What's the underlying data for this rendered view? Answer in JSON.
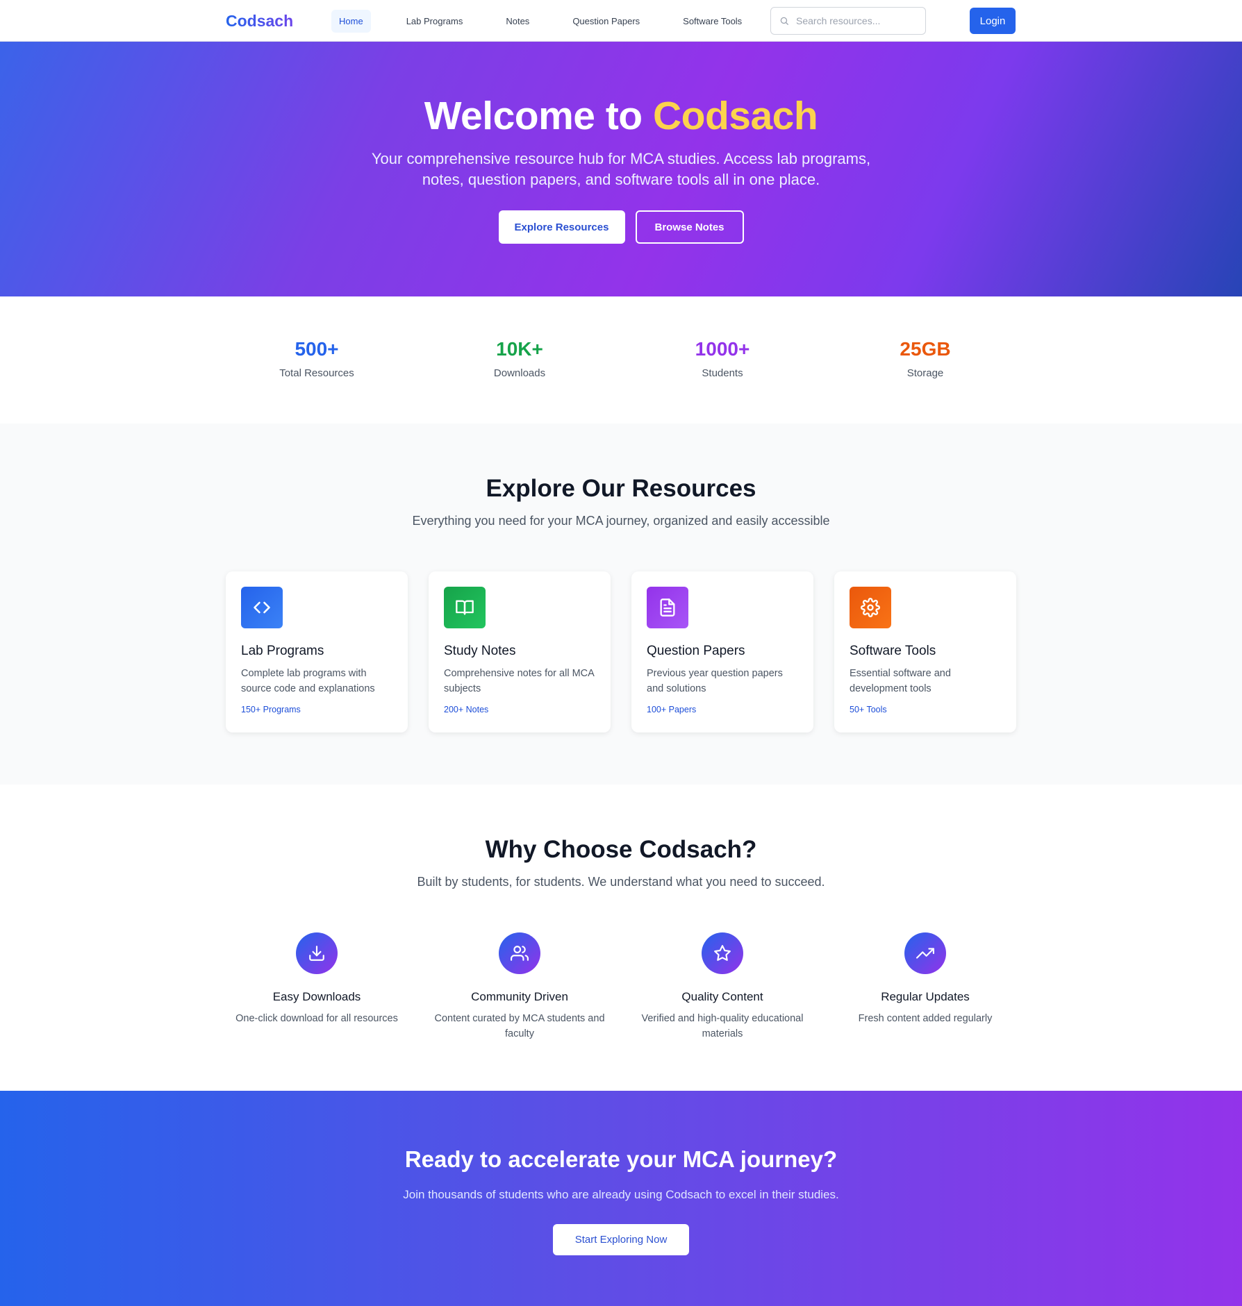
{
  "nav": {
    "logo": "Codsach",
    "links": [
      {
        "label": "Home",
        "active": true
      },
      {
        "label": "Lab Programs"
      },
      {
        "label": "Notes"
      },
      {
        "label": "Question Papers"
      },
      {
        "label": "Software Tools"
      }
    ],
    "search_placeholder": "Search resources...",
    "login_label": "Login"
  },
  "hero": {
    "title_prefix": "Welcome to",
    "title_accent": "Codsach",
    "subtitle": "Your comprehensive resource hub for MCA studies. Access lab programs, notes, question papers, and software tools all in one place.",
    "primary_button": "Explore Resources",
    "secondary_button": "Browse Notes"
  },
  "stats": [
    {
      "value": "500+",
      "label": "Total Resources",
      "color": "#2563eb"
    },
    {
      "value": "10K+",
      "label": "Downloads",
      "color": "#16a34a"
    },
    {
      "value": "1000+",
      "label": "Students",
      "color": "#9333ea"
    },
    {
      "value": "25GB",
      "label": "Storage",
      "color": "#ea580c"
    }
  ],
  "resources": {
    "title": "Explore Our Resources",
    "subtitle": "Everything you need for your MCA journey, organized and easily accessible",
    "cards": [
      {
        "title": "Lab Programs",
        "description": "Complete lab programs with source code and explanations",
        "count": "150+ Programs",
        "icon": "code-icon",
        "color": "#2563eb"
      },
      {
        "title": "Study Notes",
        "description": "Comprehensive notes for all MCA subjects",
        "count": "200+ Notes",
        "icon": "book-icon",
        "color": "#16a34a"
      },
      {
        "title": "Question Papers",
        "description": "Previous year question papers and solutions",
        "count": "100+ Papers",
        "icon": "document-icon",
        "color": "#9333ea"
      },
      {
        "title": "Software Tools",
        "description": "Essential software and development tools",
        "count": "50+ Tools",
        "icon": "gear-icon",
        "color": "#ea580c"
      }
    ]
  },
  "why": {
    "title": "Why Choose Codsach?",
    "subtitle": "Built by students, for students. We understand what you need to succeed.",
    "features": [
      {
        "title": "Easy Downloads",
        "description": "One-click download for all resources",
        "icon": "download-icon"
      },
      {
        "title": "Community Driven",
        "description": "Content curated by MCA students and faculty",
        "icon": "users-icon"
      },
      {
        "title": "Quality Content",
        "description": "Verified and high-quality educational materials",
        "icon": "star-icon"
      },
      {
        "title": "Regular Updates",
        "description": "Fresh content added regularly",
        "icon": "trending-up-icon"
      }
    ]
  },
  "cta": {
    "title": "Ready to accelerate your MCA journey?",
    "subtitle": "Join thousands of students who are already using Codsach to excel in their studies.",
    "button": "Start Exploring Now"
  }
}
